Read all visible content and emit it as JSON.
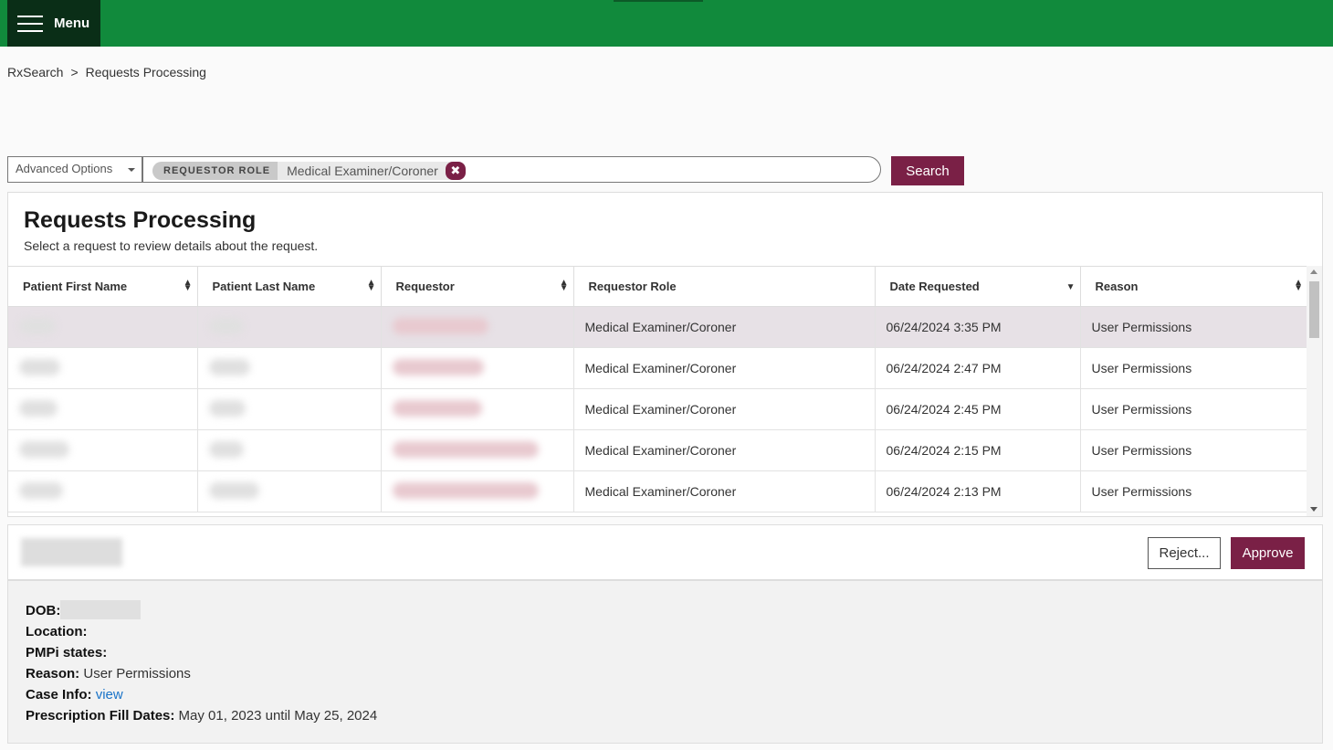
{
  "header": {
    "menu_label": "Menu"
  },
  "breadcrumb": {
    "items": [
      "RxSearch",
      "Requests Processing"
    ],
    "separator": ">"
  },
  "search": {
    "advanced_label": "Advanced Options",
    "chip_key": "REQUESTOR ROLE",
    "chip_value": "Medical Examiner/Coroner",
    "button_label": "Search"
  },
  "panel": {
    "title": "Requests Processing",
    "subtitle": "Select a request to review details about the request."
  },
  "table": {
    "columns": [
      "Patient First Name",
      "Patient Last Name",
      "Requestor",
      "Requestor Role",
      "Date Requested",
      "Reason"
    ],
    "rows": [
      {
        "role": "Medical Examiner/Coroner",
        "date": "06/24/2024 3:35 PM",
        "reason": "User Permissions"
      },
      {
        "role": "Medical Examiner/Coroner",
        "date": "06/24/2024 2:47 PM",
        "reason": "User Permissions"
      },
      {
        "role": "Medical Examiner/Coroner",
        "date": "06/24/2024 2:45 PM",
        "reason": "User Permissions"
      },
      {
        "role": "Medical Examiner/Coroner",
        "date": "06/24/2024 2:15 PM",
        "reason": "User Permissions"
      },
      {
        "role": "Medical Examiner/Coroner",
        "date": "06/24/2024 2:13 PM",
        "reason": "User Permissions"
      }
    ]
  },
  "detail": {
    "reject_label": "Reject...",
    "approve_label": "Approve",
    "dob_label": "DOB:",
    "location_label": "Location:",
    "pmpi_label": "PMPi states:",
    "reason_label": "Reason:",
    "reason_value": "User Permissions",
    "case_label": "Case Info:",
    "case_link": "view",
    "fill_label": "Prescription Fill Dates:",
    "fill_value": "May 01, 2023 until May 25, 2024"
  }
}
